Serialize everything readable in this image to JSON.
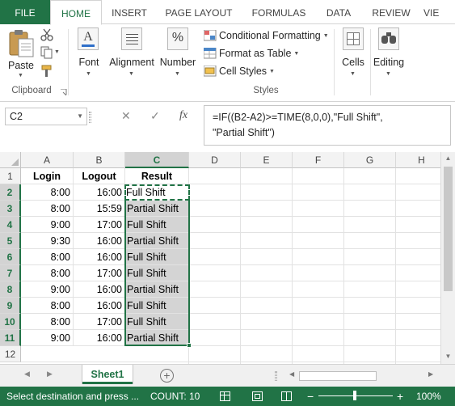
{
  "ribbon": {
    "tabs": [
      "FILE",
      "HOME",
      "INSERT",
      "PAGE LAYOUT",
      "FORMULAS",
      "DATA",
      "REVIEW",
      "VIE"
    ],
    "clipboard": {
      "paste_label": "Paste",
      "group_label": "Clipboard"
    },
    "font": {
      "label": "Font"
    },
    "alignment": {
      "label": "Alignment"
    },
    "number": {
      "label": "Number",
      "icon_glyph": "%"
    },
    "styles": {
      "conditional_formatting": "Conditional Formatting",
      "format_as_table": "Format as Table",
      "cell_styles": "Cell Styles",
      "group_label": "Styles"
    },
    "cells": {
      "label": "Cells"
    },
    "editing": {
      "label": "Editing"
    }
  },
  "formula_bar": {
    "name_box": "C2",
    "fx_label": "fx",
    "formula_line1": "=IF((B2-A2)>=TIME(8,0,0),\"Full Shift\",",
    "formula_line2": "\"Partial Shift\")"
  },
  "grid": {
    "columns": [
      "A",
      "B",
      "C",
      "D",
      "E",
      "F",
      "G",
      "H"
    ],
    "rows": [
      "1",
      "2",
      "3",
      "4",
      "5",
      "6",
      "7",
      "8",
      "9",
      "10",
      "11",
      "12"
    ],
    "headers": {
      "login": "Login",
      "logout": "Logout",
      "result": "Result"
    },
    "data": [
      {
        "login": "8:00",
        "logout": "16:00",
        "result": "Full Shift"
      },
      {
        "login": "8:00",
        "logout": "15:59",
        "result": "Partial Shift"
      },
      {
        "login": "9:00",
        "logout": "17:00",
        "result": "Full Shift"
      },
      {
        "login": "9:30",
        "logout": "16:00",
        "result": "Partial Shift"
      },
      {
        "login": "8:00",
        "logout": "16:00",
        "result": "Full Shift"
      },
      {
        "login": "8:00",
        "logout": "17:00",
        "result": "Full Shift"
      },
      {
        "login": "9:00",
        "logout": "16:00",
        "result": "Partial Shift"
      },
      {
        "login": "8:00",
        "logout": "16:00",
        "result": "Full Shift"
      },
      {
        "login": "8:00",
        "logout": "17:00",
        "result": "Full Shift"
      },
      {
        "login": "9:00",
        "logout": "16:00",
        "result": "Partial Shift"
      }
    ]
  },
  "sheets": {
    "active": "Sheet1"
  },
  "status_bar": {
    "message": "Select destination and press ...",
    "count": "COUNT: 10",
    "zoom": "100%"
  },
  "colors": {
    "accent": "#217346",
    "selection_fill": "#d4d4d4"
  }
}
